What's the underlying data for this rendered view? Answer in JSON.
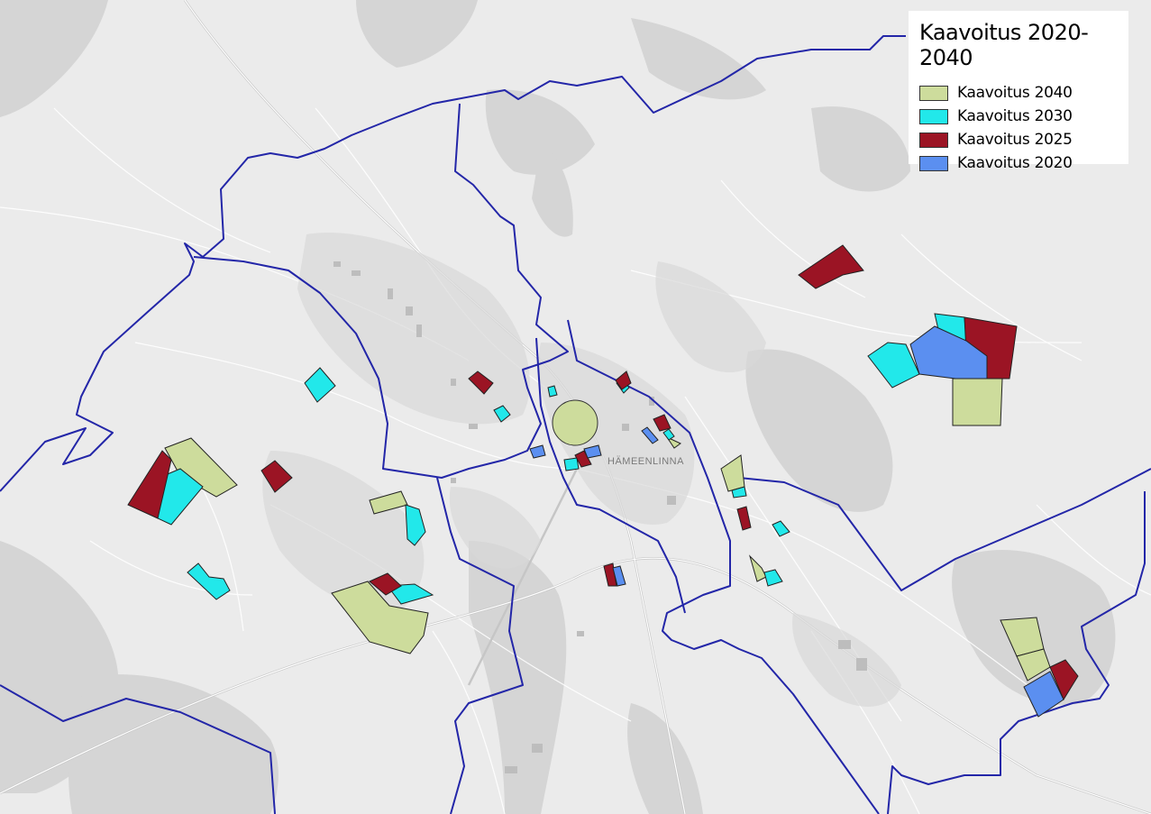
{
  "legend": {
    "title": "Kaavoitus 2020-2040",
    "items": [
      {
        "label": "Kaavoitus 2040",
        "color": "#cddc9c"
      },
      {
        "label": "Kaavoitus 2030",
        "color": "#22e8ea"
      },
      {
        "label": "Kaavoitus 2025",
        "color": "#9b1424"
      },
      {
        "label": "Kaavoitus 2020",
        "color": "#5b8ff0"
      }
    ]
  },
  "map": {
    "city_label": "HÄMEENLINNA",
    "boundary_color": "#2326a8",
    "base_color": "#e9e9e9",
    "water_color": "#d6d6d6",
    "road_color": "#ffffff"
  }
}
